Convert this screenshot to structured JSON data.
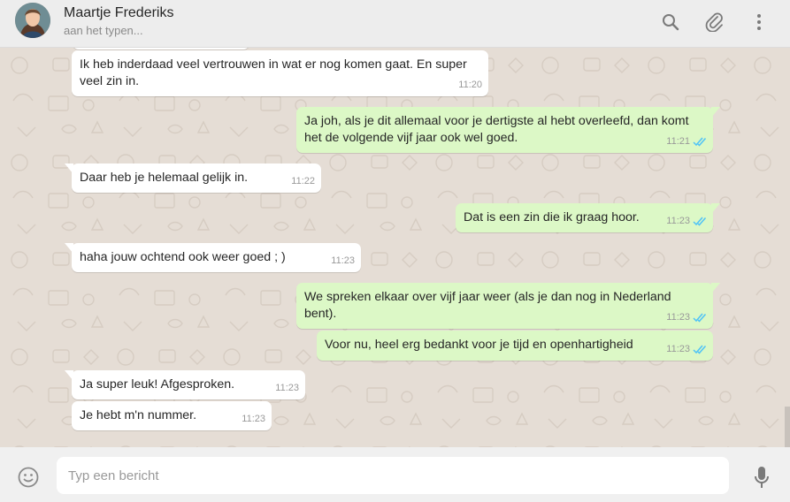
{
  "header": {
    "contact_name": "Maartje Frederiks",
    "status": "aan het typen...",
    "icons": [
      "search-icon",
      "attach-icon",
      "menu-icon"
    ]
  },
  "messages": [
    {
      "direction": "in",
      "lines": [
        "Ik heb inderdaad veel vertrouwen in wat er nog komen gaat. En super",
        "veel zin in."
      ],
      "time": "11:20"
    },
    {
      "direction": "out",
      "lines": [
        "Ja joh, als je dit allemaal voor je dertigste al hebt overleefd, dan komt",
        "het de volgende vijf jaar ook wel goed."
      ],
      "time": "11:21",
      "status": "read"
    },
    {
      "direction": "in",
      "lines": [
        "Daar heb je helemaal gelijk in."
      ],
      "time": "11:22"
    },
    {
      "direction": "out",
      "lines": [
        "Dat is een zin die ik graag hoor."
      ],
      "time": "11:23",
      "status": "read"
    },
    {
      "direction": "in",
      "lines": [
        "haha jouw ochtend ook weer goed ; )"
      ],
      "time": "11:23"
    },
    {
      "direction": "out",
      "lines": [
        "We spreken elkaar over vijf jaar weer (als je dan nog in Nederland bent)."
      ],
      "time": "11:23",
      "status": "read"
    },
    {
      "direction": "out",
      "lines": [
        "Voor nu, heel erg bedankt voor je tijd en openhartigheid"
      ],
      "time": "11:23",
      "status": "read"
    },
    {
      "direction": "in",
      "lines": [
        "Ja super leuk! Afgesproken."
      ],
      "time": "11:23"
    },
    {
      "direction": "in",
      "lines": [
        "Je hebt m'n nummer."
      ],
      "time": "11:23"
    }
  ],
  "composer": {
    "placeholder": "Typ een bericht",
    "icons": [
      "emoji-icon",
      "microphone-icon"
    ]
  },
  "colors": {
    "header_bg": "#ededed",
    "chat_bg": "#e5ddd5",
    "incoming_bubble": "#ffffff",
    "outgoing_bubble": "#dcf8c6",
    "read_ticks": "#4fc3f7"
  }
}
